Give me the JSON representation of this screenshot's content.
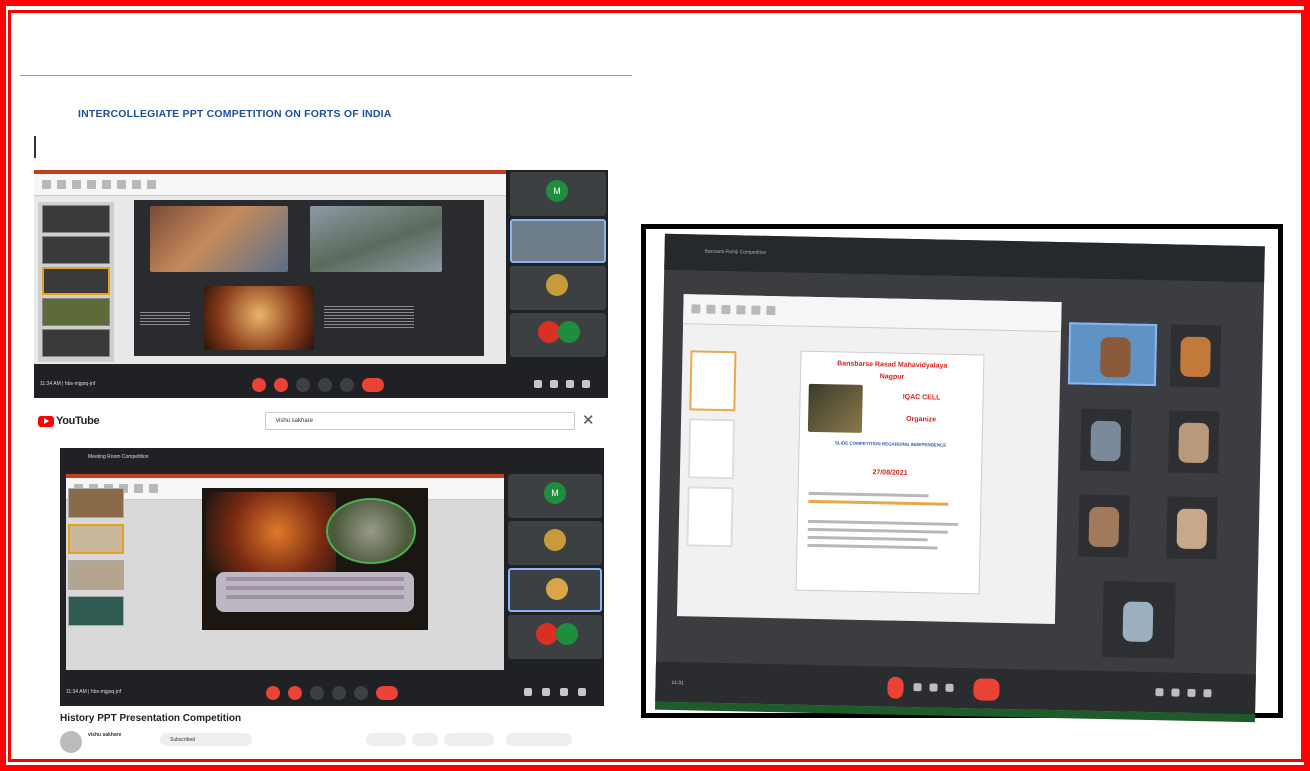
{
  "document": {
    "title": "INTERCOLLEGIATE PPT COMPETITION ON FORTS OF INDIA"
  },
  "youtube": {
    "logo_text": "YouTube",
    "search_value": "vishu sakhare",
    "video_title": "History PPT Presentation Competition",
    "channel_name": "vishu sakhare",
    "subscribe_label": "Subscribed"
  },
  "meet_left": {
    "header_title": "Meeting Room Competition",
    "footer_time": "11:34 AM",
    "footer_code": "hbs-mjgoq-jnf",
    "participant_initial": "M"
  },
  "meet_right": {
    "header_title": "Bansanti Ramji Competition",
    "slide_title_line1": "Bansbarse Rasad Mahavidyalaya",
    "slide_title_line2": "Nagpur",
    "slide_title_line3": "IQAC CELL",
    "slide_title_line4": "Organize",
    "slide_subtitle": "SLIDE COMPETITION REGARDING INDEPENDENCE",
    "slide_date": "27/08/2021",
    "footer_time": "11:31"
  },
  "colors": {
    "border": "#ff0000",
    "doc_title": "#1f4e9c",
    "meet_bg": "#202124",
    "meet_end_call": "#ea4335",
    "youtube_red": "#ff0000"
  }
}
